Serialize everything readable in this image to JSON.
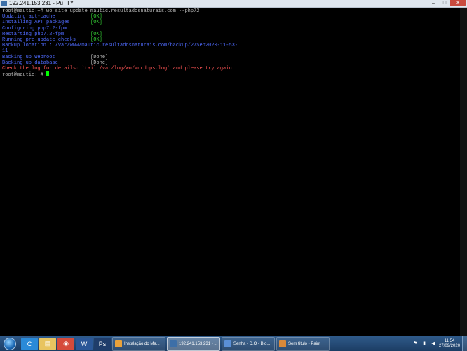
{
  "window": {
    "title": "192.241.153.231 - PuTTY",
    "minimize": "–",
    "maximize": "□",
    "close": "✕"
  },
  "terminal": {
    "lines": [
      {
        "text": "root@mautic:~# wo site update mautic.resultadosnaturais.com --php72",
        "color": "w"
      },
      {
        "text": "Updating apt-cache            ",
        "color": "b",
        "status": "[OK]",
        "status_color": "g"
      },
      {
        "text": "Installing APT packages       ",
        "color": "b",
        "status": "[OK]",
        "status_color": "g"
      },
      {
        "text": "Configuring php7.2-fpm",
        "color": "b"
      },
      {
        "text": "Restarting php7.2-fpm         ",
        "color": "b",
        "status": "[OK]",
        "status_color": "g"
      },
      {
        "text": "Running pre-update checks     ",
        "color": "b",
        "status": "[OK]",
        "status_color": "g"
      },
      {
        "text": "Backup location : /var/www/mautic.resultadosnaturais.com/backup/27Sep2020-11-53-",
        "color": "b"
      },
      {
        "text": "11",
        "color": "b"
      },
      {
        "text": "Backing up Webroot            ",
        "color": "b",
        "status": "[Done]",
        "status_color": "w"
      },
      {
        "text": "Backing up database           ",
        "color": "b",
        "status": "[Done]",
        "status_color": "w"
      },
      {
        "text": "Check the log for details: `tail /var/log/wo/wordops.log` and please try again",
        "color": "r"
      },
      {
        "text": "root@mautic:~# ",
        "color": "w",
        "cursor": true
      }
    ]
  },
  "taskbar": {
    "tasks": [
      {
        "label": "Instalação do Ma...",
        "icon_color": "#e9a23b"
      },
      {
        "label": "192.241.153.231 - ...",
        "icon_color": "#3d6fa8",
        "active": true
      },
      {
        "label": "Senha - D.O - Blo...",
        "icon_color": "#5a8fd6"
      },
      {
        "label": "Sem título - Paint",
        "icon_color": "#d9893a"
      }
    ],
    "pinned": [
      {
        "name": "ccleaner-icon",
        "glyph": "C",
        "color": "#2a8ad8"
      },
      {
        "name": "explorer-icon",
        "glyph": "▤",
        "color": "#e8c460"
      },
      {
        "name": "chrome-icon",
        "glyph": "◉",
        "color": "#d64b3b"
      },
      {
        "name": "word-icon",
        "glyph": "W",
        "color": "#2b5797"
      },
      {
        "name": "photoshop-icon",
        "glyph": "Ps",
        "color": "#1f3d6b"
      }
    ],
    "clock": {
      "time": "11:54",
      "date": "27/09/2020"
    }
  }
}
